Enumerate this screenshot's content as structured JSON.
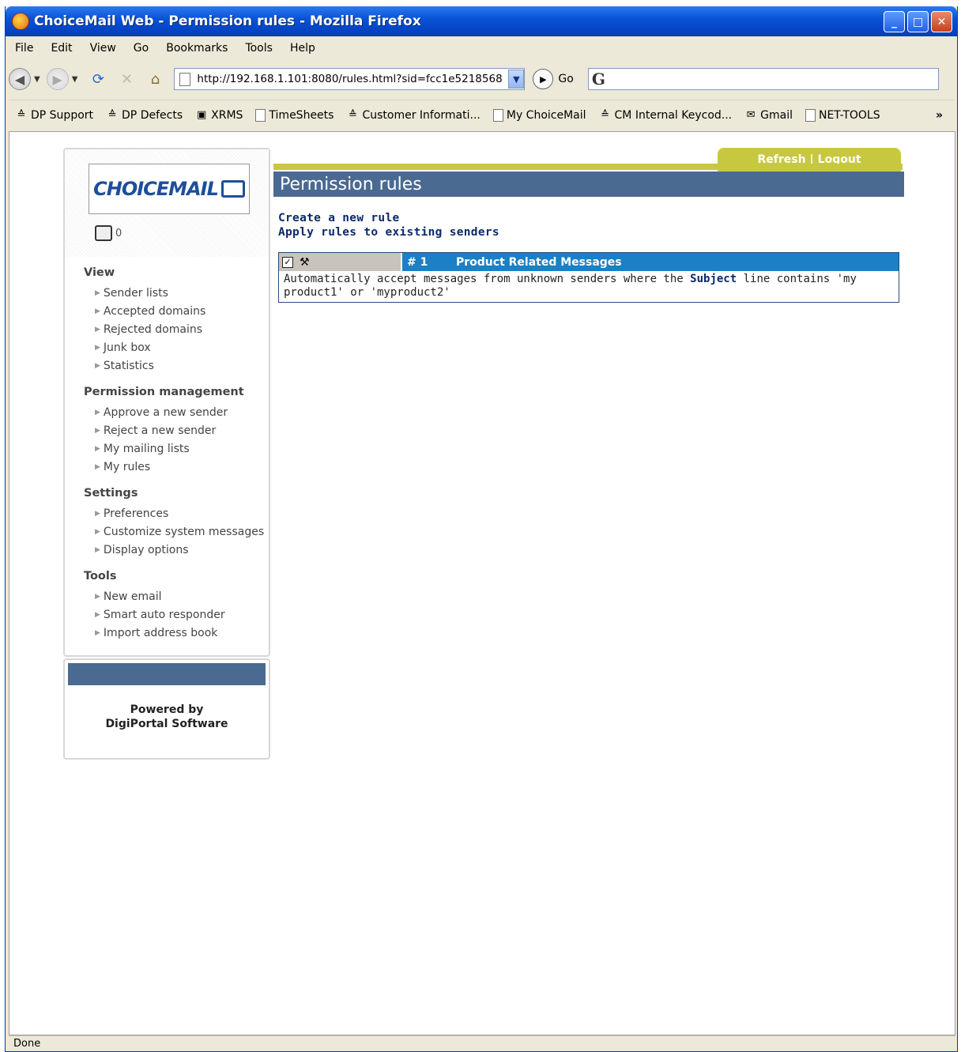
{
  "window": {
    "title": "ChoiceMail Web - Permission rules - Mozilla Firefox"
  },
  "menu": [
    "File",
    "Edit",
    "View",
    "Go",
    "Bookmarks",
    "Tools",
    "Help"
  ],
  "navbar": {
    "url": "http://192.168.1.101:8080/rules.html?sid=fcc1e5218568",
    "go_label": "Go"
  },
  "bookmarks": [
    "DP Support",
    "DP Defects",
    "XRMS",
    "TimeSheets",
    "Customer Informati...",
    "My ChoiceMail",
    "CM Internal Keycod...",
    "Gmail",
    "NET-TOOLS"
  ],
  "bookmarks_more": "»",
  "sidebar": {
    "logo_text": "CHOICEMAIL",
    "count": "0",
    "sections": [
      {
        "title": "View",
        "items": [
          "Sender lists",
          "Accepted domains",
          "Rejected domains",
          "Junk box",
          "Statistics"
        ]
      },
      {
        "title": "Permission management",
        "items": [
          "Approve a new sender",
          "Reject a new sender",
          "My mailing lists",
          "My rules"
        ]
      },
      {
        "title": "Settings",
        "items": [
          "Preferences",
          "Customize system messages",
          "Display options"
        ]
      },
      {
        "title": "Tools",
        "items": [
          "New email",
          "Smart auto responder",
          "Import address book"
        ]
      }
    ],
    "powered_line1": "Powered by",
    "powered_line2": "DigiPortal Software"
  },
  "header": {
    "refresh": "Refresh",
    "separator": "|",
    "logout": "Logout",
    "page_title": "Permission rules"
  },
  "actions": {
    "create": "Create a new rule",
    "apply": "Apply rules to existing senders"
  },
  "rule": {
    "checked": true,
    "number": "# 1",
    "name": "Product Related Messages",
    "desc_before": "Automatically accept messages from unknown senders where the ",
    "desc_bold": "Subject",
    "desc_after": " line contains 'my product1' or 'myproduct2'"
  },
  "status": "Done"
}
